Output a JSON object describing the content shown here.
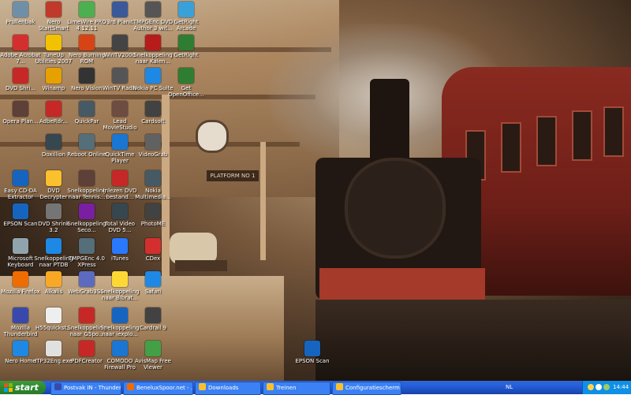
{
  "desktop_icons": [
    {
      "label": "Prullenbak",
      "icon": "recycle-bin-icon",
      "color": "#6f8fa8"
    },
    {
      "label": "Nero StartSmart",
      "icon": "nero-icon",
      "color": "#c0392b"
    },
    {
      "label": "LimeWire PRO 4.12.11",
      "icon": "limewire-icon",
      "color": "#4caf50"
    },
    {
      "label": "3rd Planit",
      "icon": "planit-icon",
      "color": "#3b5998"
    },
    {
      "label": "TMPGEnc DVD Author 3 wit...",
      "icon": "tmpgenc-icon",
      "color": "#555555"
    },
    {
      "label": "GetRight Arcade",
      "icon": "getright-icon",
      "color": "#3aa0d8"
    },
    {
      "label": "Adobe Acrobat 7...",
      "icon": "acrobat-icon",
      "color": "#d32f2f"
    },
    {
      "label": "TuneUp Utilities 2007",
      "icon": "tuneup-icon",
      "color": "#f2c200"
    },
    {
      "label": "Nero Burning ROM",
      "icon": "nero-burning-icon",
      "color": "#d84315"
    },
    {
      "label": "WinTV2000",
      "icon": "wintv-icon",
      "color": "#444444"
    },
    {
      "label": "Snelkoppeling naar Kalen...",
      "icon": "calendar-shortcut-icon",
      "color": "#b71c1c"
    },
    {
      "label": "GetRight",
      "icon": "getright-globe-icon",
      "color": "#2e7d32"
    },
    {
      "label": "DVD Shri...",
      "icon": "dvd-shrink-icon",
      "color": "#c62828"
    },
    {
      "label": "Winamp",
      "icon": "winamp-icon",
      "color": "#e6a100"
    },
    {
      "label": "Nero Vision",
      "icon": "nero-vision-icon",
      "color": "#333333"
    },
    {
      "label": "WinTV Radio",
      "icon": "wintv-radio-icon",
      "color": "#555555"
    },
    {
      "label": "Nokia PC Suite",
      "icon": "nokia-pc-suite-icon",
      "color": "#1e88e5"
    },
    {
      "label": "Get OpenOffice...",
      "icon": "openoffice-icon",
      "color": "#2e7d32"
    },
    {
      "label": "Opera Plan...",
      "icon": "opera-plan-icon",
      "color": "#5d4037"
    },
    {
      "label": "AdbeRdr...",
      "icon": "adobe-reader-icon",
      "color": "#c62828"
    },
    {
      "label": "QuickPar",
      "icon": "quickpar-icon",
      "color": "#455a64"
    },
    {
      "label": "Lead MovieStudio 11",
      "icon": "movie-studio-icon",
      "color": "#6d4c41"
    },
    {
      "label": "Cardsoft",
      "icon": "cardsoft-icon",
      "color": "#424242"
    },
    {
      "label": "Doxillion",
      "icon": "doxillion-icon",
      "color": "#37474f"
    },
    {
      "label": "Reboot Online",
      "icon": "reboot-icon",
      "color": "#546e7a"
    },
    {
      "label": "QuickTime Player",
      "icon": "quicktime-icon",
      "color": "#1976d2"
    },
    {
      "label": "VideoGrab",
      "icon": "videograb-icon",
      "color": "#616161"
    },
    {
      "label": "Easy CD-DA Extractor",
      "icon": "easy-cd-icon",
      "color": "#1565c0"
    },
    {
      "label": "DVD Decrypter",
      "icon": "dvd-decrypter-icon",
      "color": "#fbc02d"
    },
    {
      "label": "Snelkoppeling naar Tennis...",
      "icon": "tennis-shortcut-icon",
      "color": "#5d4037"
    },
    {
      "label": "Inlezen DVD bestand...",
      "icon": "dvd-read-icon",
      "color": "#c62828"
    },
    {
      "label": "Nokia Multimedia...",
      "icon": "nokia-multimedia-icon",
      "color": "#455a64"
    },
    {
      "label": "EPSON Scan",
      "icon": "epson-scan-icon",
      "color": "#1565c0"
    },
    {
      "label": "DVD Shrink 3.2",
      "icon": "dvd-shrink-32-icon",
      "color": "#757575"
    },
    {
      "label": "Snelkoppeling Seco...",
      "icon": "seco-shortcut-icon",
      "color": "#7b1fa2"
    },
    {
      "label": "Total Video DVD 5...",
      "icon": "total-video-icon",
      "color": "#37474f"
    },
    {
      "label": "PhotoME",
      "icon": "photome-icon",
      "color": "#424242"
    },
    {
      "label": "Microsoft Keyboard",
      "icon": "keyboard-icon",
      "color": "#90a4ae"
    },
    {
      "label": "Snelkoppeling naar PTDB",
      "icon": "ptdb-shortcut-icon",
      "color": "#1e88e5"
    },
    {
      "label": "TMPGEnc 4.0 XPress",
      "icon": "tmpgenc-xpress-icon",
      "color": "#546e7a"
    },
    {
      "label": "iTunes",
      "icon": "itunes-icon",
      "color": "#2979ff"
    },
    {
      "label": "CDex",
      "icon": "cdex-icon",
      "color": "#d32f2f"
    },
    {
      "label": "Mozilla Firefox",
      "icon": "firefox-icon",
      "color": "#ef6c00"
    },
    {
      "label": "Alkalis",
      "icon": "alkalis-icon",
      "color": "#f9a825"
    },
    {
      "label": "WebGrab3S...",
      "icon": "webgrab-icon",
      "color": "#5c6bc0"
    },
    {
      "label": "Snelkoppeling naar Blbrat...",
      "icon": "blbrat-shortcut-icon",
      "color": "#fdd835"
    },
    {
      "label": "Safari",
      "icon": "safari-icon",
      "color": "#1e88e5"
    },
    {
      "label": "Mozilla Thunderbird",
      "icon": "thunderbird-icon",
      "color": "#3949ab"
    },
    {
      "label": "H55quickst...",
      "icon": "h55-icon",
      "color": "#eeeeee"
    },
    {
      "label": "Snelkoppeling naar G5po...",
      "icon": "g5po-shortcut-icon",
      "color": "#c62828"
    },
    {
      "label": "Snelkoppeling naar iexplo...",
      "icon": "iexplore-shortcut-icon",
      "color": "#1565c0"
    },
    {
      "label": "Cardrail 9",
      "icon": "cardrail-icon",
      "color": "#424242"
    },
    {
      "label": "Nero Home",
      "icon": "nero-home-icon",
      "color": "#1e88e5"
    },
    {
      "label": "ITP32Eng.exe",
      "icon": "exe-icon",
      "color": "#e0e0e0"
    },
    {
      "label": "PDFCreator",
      "icon": "pdfcreator-icon",
      "color": "#c62828"
    },
    {
      "label": "COMODO Firewall Pro",
      "icon": "comodo-icon",
      "color": "#1976d2"
    },
    {
      "label": "AvisMap Free Viewer",
      "icon": "avismap-icon",
      "color": "#43a047"
    },
    {
      "label": "EPSON Scan",
      "icon": "epson-scan-2-icon",
      "color": "#1565c0"
    }
  ],
  "wallpaper": {
    "platform_sign": "PLATFORM NO 1"
  },
  "taskbar": {
    "start_label": "start",
    "buttons": [
      {
        "label": "Postvak IN - Thunder...",
        "color": "#3949ab"
      },
      {
        "label": "BeneluxSpoor.net - ...",
        "color": "#ef6c00"
      },
      {
        "label": "Downloads",
        "color": "#fbc02d"
      },
      {
        "label": "Treinen",
        "color": "#fbc02d"
      },
      {
        "label": "Configuratiescherm",
        "color": "#fbc02d"
      }
    ],
    "language": "NL",
    "clock": "14:44"
  }
}
